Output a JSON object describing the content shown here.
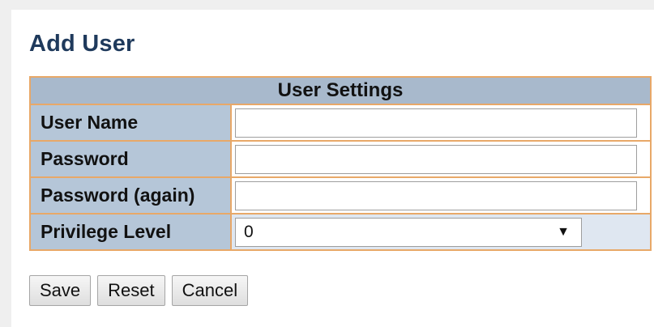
{
  "page": {
    "title": "Add User"
  },
  "user_settings": {
    "header": "User Settings",
    "rows": [
      {
        "label": "User Name",
        "value": ""
      },
      {
        "label": "Password",
        "value": ""
      },
      {
        "label": "Password (again)",
        "value": ""
      },
      {
        "label": "Privilege Level",
        "selected": "0"
      }
    ]
  },
  "buttons": {
    "save": "Save",
    "reset": "Reset",
    "cancel": "Cancel"
  },
  "icons": {
    "select_arrow": "▼"
  },
  "colors": {
    "title": "#1f3a5c",
    "table_border": "#e8a868",
    "header_bg": "#a8b9cc",
    "label_bg": "#b5c6d8"
  }
}
